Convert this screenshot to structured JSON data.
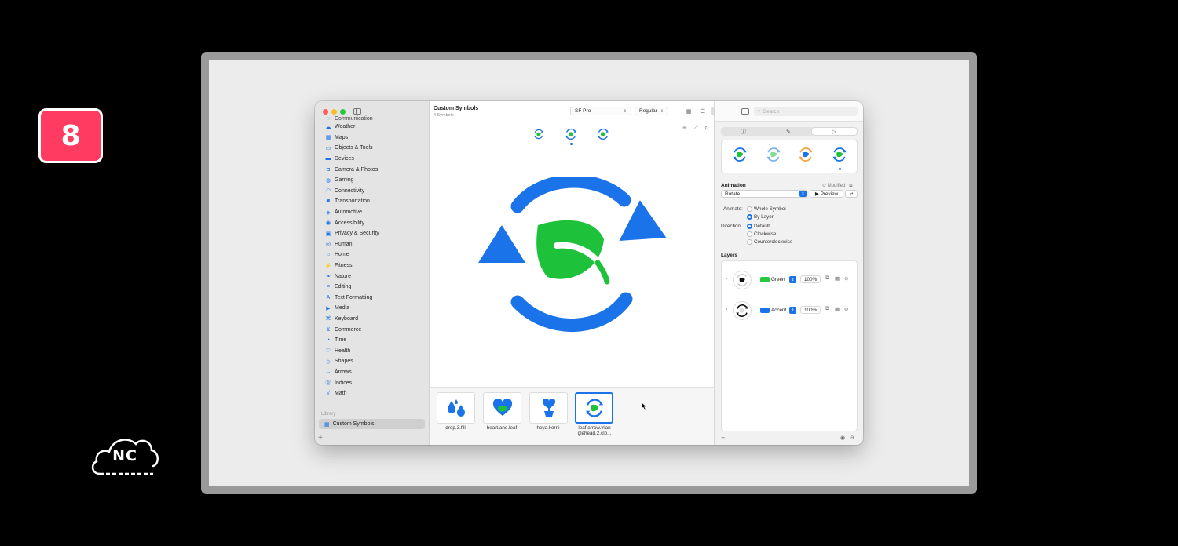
{
  "overlay": {
    "badge": "8",
    "logo_text": "NC"
  },
  "window": {
    "title": "Custom Symbols",
    "subtitle": "4 Symbols",
    "font_select": "SF Pro",
    "weight_select": "Regular",
    "search_placeholder": "Search"
  },
  "sidebar": {
    "partial_item": "Communication",
    "items": [
      {
        "label": "Weather",
        "icon": "cloud-icon"
      },
      {
        "label": "Maps",
        "icon": "map-icon"
      },
      {
        "label": "Objects & Tools",
        "icon": "folder-icon"
      },
      {
        "label": "Devices",
        "icon": "display-icon"
      },
      {
        "label": "Camera & Photos",
        "icon": "camera-icon"
      },
      {
        "label": "Gaming",
        "icon": "gamecontroller-icon"
      },
      {
        "label": "Connectivity",
        "icon": "wifi-icon"
      },
      {
        "label": "Transportation",
        "icon": "car-icon"
      },
      {
        "label": "Automotive",
        "icon": "automotive-icon"
      },
      {
        "label": "Accessibility",
        "icon": "accessibility-icon"
      },
      {
        "label": "Privacy & Security",
        "icon": "lock-icon"
      },
      {
        "label": "Human",
        "icon": "person-icon"
      },
      {
        "label": "Home",
        "icon": "house-icon"
      },
      {
        "label": "Fitness",
        "icon": "figure-icon"
      },
      {
        "label": "Nature",
        "icon": "leaf-icon"
      },
      {
        "label": "Editing",
        "icon": "slider-icon"
      },
      {
        "label": "Text Formatting",
        "icon": "textformat-icon"
      },
      {
        "label": "Media",
        "icon": "playpause-icon"
      },
      {
        "label": "Keyboard",
        "icon": "command-icon"
      },
      {
        "label": "Commerce",
        "icon": "cart-icon"
      },
      {
        "label": "Time",
        "icon": "timer-icon"
      },
      {
        "label": "Health",
        "icon": "heart-icon"
      },
      {
        "label": "Shapes",
        "icon": "shapes-icon"
      },
      {
        "label": "Arrows",
        "icon": "arrow-icon"
      },
      {
        "label": "Indices",
        "icon": "index-icon"
      },
      {
        "label": "Math",
        "icon": "sqrt-icon"
      }
    ],
    "library_header": "Library",
    "library_item": "Custom Symbols"
  },
  "gallery": {
    "tiles": [
      {
        "label": "drop.3.fill"
      },
      {
        "label": "heart.and.leaf"
      },
      {
        "label": "hoya.kerrii"
      },
      {
        "label": "leaf.arrow.trian\nglehead.2.clo..."
      }
    ]
  },
  "inspector": {
    "animation_title": "Animation",
    "modified": "Modified",
    "animation_value": "Rotate",
    "preview_label": "Preview",
    "animate_label": "Animate:",
    "animate_options": [
      "Whole Symbol",
      "By Layer"
    ],
    "animate_selected": "By Layer",
    "direction_label": "Direction:",
    "direction_options": [
      "Default",
      "Clockwise",
      "Counterclockwise"
    ],
    "direction_selected": "Default",
    "layers_title": "Layers",
    "layers": [
      {
        "name": "Green",
        "opacity": "100%",
        "color": "#28c840"
      },
      {
        "name": "Accent",
        "opacity": "100%",
        "color": "#1a73e8"
      }
    ]
  },
  "colors": {
    "accent": "#1a73e8",
    "leaf_green": "#1ec13a",
    "badge": "#ff3b62"
  }
}
